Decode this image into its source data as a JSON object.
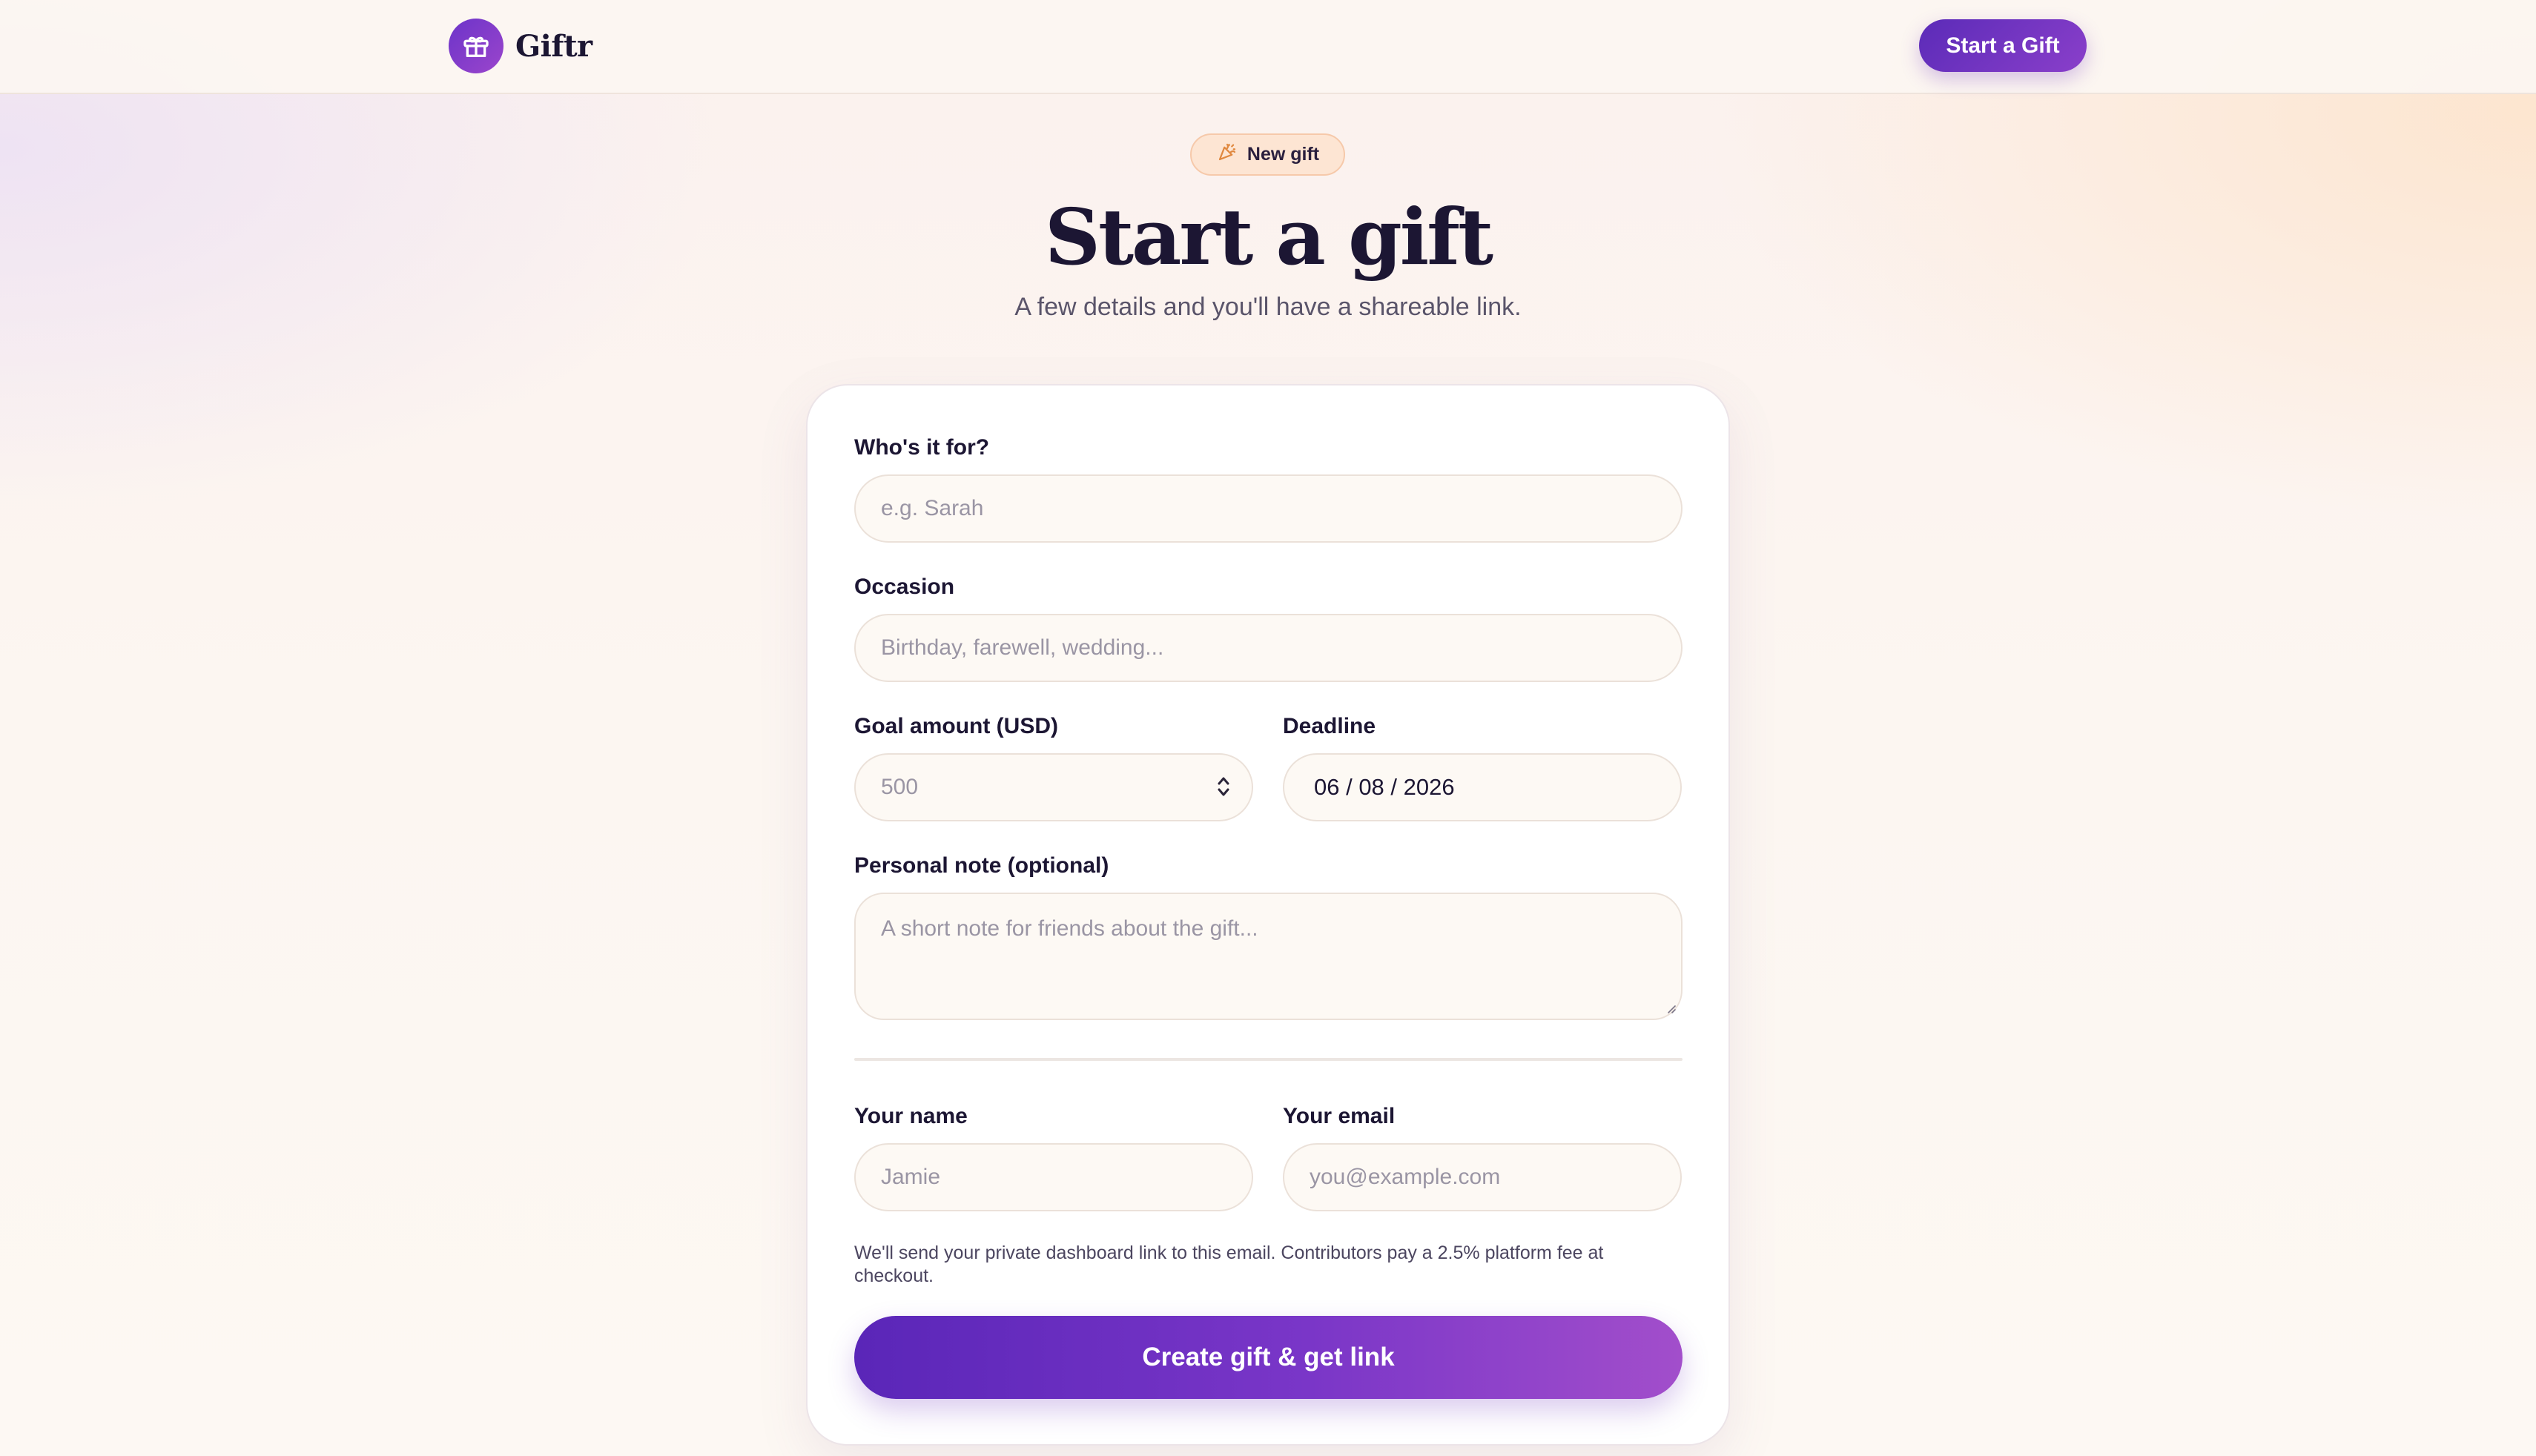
{
  "brand": {
    "name": "Giftr",
    "logo_icon": "gift-icon"
  },
  "header": {
    "cta_label": "Start a Gift"
  },
  "hero": {
    "badge_icon": "party-popper-icon",
    "badge_label": "New gift",
    "title": "Start a gift",
    "subtitle": "A few details and you'll have a shareable link."
  },
  "form": {
    "recipient": {
      "label": "Who's it for?",
      "placeholder": "e.g. Sarah",
      "value": ""
    },
    "occasion": {
      "label": "Occasion",
      "placeholder": "Birthday, farewell, wedding...",
      "value": ""
    },
    "goal": {
      "label": "Goal amount (USD)",
      "placeholder": "500",
      "value": ""
    },
    "deadline": {
      "label": "Deadline",
      "value": "06 / 08 / 2026"
    },
    "note": {
      "label": "Personal note (optional)",
      "placeholder": "A short note for friends about the gift...",
      "value": ""
    },
    "your_name": {
      "label": "Your name",
      "placeholder": "Jamie",
      "value": ""
    },
    "your_email": {
      "label": "Your email",
      "placeholder": "you@example.com",
      "value": ""
    },
    "disclaimer": "We'll send your private dashboard link to this email. Contributors pay a 2.5% platform fee at checkout.",
    "submit_label": "Create gift & get link"
  },
  "colors": {
    "accent": "#6c34c9",
    "accent_end": "#a24ecb",
    "badge_bg": "#fde5d3",
    "input_bg": "#fdf9f4",
    "text": "#1c1633"
  }
}
